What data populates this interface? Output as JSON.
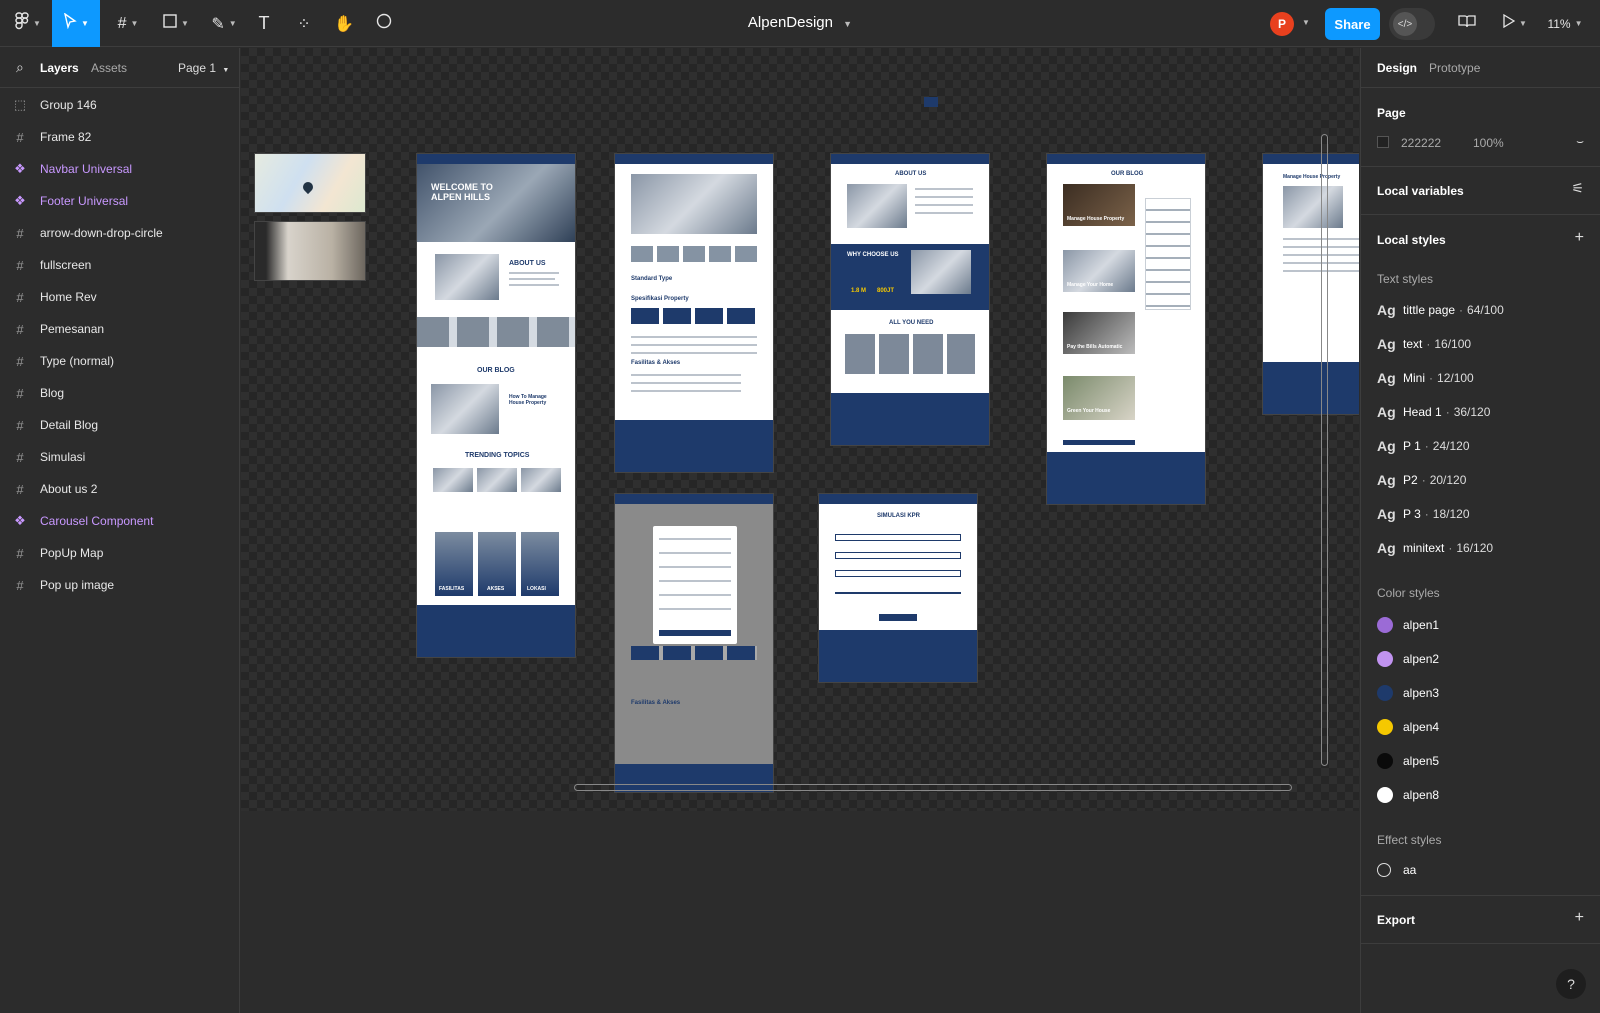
{
  "topbar": {
    "file_name": "AlpenDesign",
    "avatar_initial": "P",
    "share_label": "Share",
    "zoom": "11%"
  },
  "left_panel": {
    "tab_layers": "Layers",
    "tab_assets": "Assets",
    "page_selector": "Page 1",
    "layers": [
      {
        "name": "Group 146",
        "type": "group"
      },
      {
        "name": "Frame 82",
        "type": "frame"
      },
      {
        "name": "Navbar Universal",
        "type": "component"
      },
      {
        "name": "Footer Universal",
        "type": "component"
      },
      {
        "name": "arrow-down-drop-circle",
        "type": "frame"
      },
      {
        "name": "fullscreen",
        "type": "frame"
      },
      {
        "name": "Home Rev",
        "type": "frame"
      },
      {
        "name": "Pemesanan",
        "type": "frame"
      },
      {
        "name": "Type (normal)",
        "type": "frame"
      },
      {
        "name": "Blog",
        "type": "frame"
      },
      {
        "name": "Detail Blog",
        "type": "frame"
      },
      {
        "name": "Simulasi",
        "type": "frame"
      },
      {
        "name": "About us 2",
        "type": "frame"
      },
      {
        "name": "Carousel Component",
        "type": "component"
      },
      {
        "name": "PopUp Map",
        "type": "frame"
      },
      {
        "name": "Pop up image",
        "type": "frame"
      }
    ]
  },
  "canvas": {
    "frames": {
      "home_title": "WELCOME TO ALPEN HILLS",
      "home_about": "ABOUT US",
      "home_blog": "OUR BLOG",
      "home_blog_post": "How To Manage House Property",
      "home_trending": "TRENDING TOPICS",
      "home_cards": [
        "FASILITAS",
        "AKSES",
        "LOKASI"
      ],
      "type_name": "Standard Type",
      "type_spec": "Spesifikasi Property",
      "type_facilities": "Fasilitas & Akses",
      "about_title": "ABOUT US",
      "about_why": "WHY CHOOSE US",
      "about_stat1": "1.8 M",
      "about_stat2": "800JT",
      "about_all": "ALL YOU NEED",
      "blog_title": "OUR BLOG",
      "blog_post1": "Manage House Property",
      "blog_post2": "Manage Your Home",
      "blog_post3": "Pay the Bills Automatic",
      "blog_post4": "Green Your House",
      "detail_title": "Manage House Property",
      "simulasi_title": "SIMULASI KPR",
      "pemesanan_facilities": "Fasilitas & Akses"
    }
  },
  "right_panel": {
    "tab_design": "Design",
    "tab_prototype": "Prototype",
    "page_section": "Page",
    "page_color": "222222",
    "page_opacity": "100%",
    "local_variables": "Local variables",
    "local_styles": "Local styles",
    "text_styles_title": "Text styles",
    "text_styles": [
      {
        "name": "tittle page",
        "spec": "64/100"
      },
      {
        "name": "text",
        "spec": "16/100"
      },
      {
        "name": "Mini",
        "spec": "12/100"
      },
      {
        "name": "Head 1",
        "spec": "36/120"
      },
      {
        "name": "P 1",
        "spec": "24/120"
      },
      {
        "name": "P2",
        "spec": "20/120"
      },
      {
        "name": "P 3",
        "spec": "18/120"
      },
      {
        "name": "minitext",
        "spec": "16/120"
      }
    ],
    "color_styles_title": "Color styles",
    "color_styles": [
      {
        "name": "alpen1",
        "color": "#9b6bd6"
      },
      {
        "name": "alpen2",
        "color": "#c193f0"
      },
      {
        "name": "alpen3",
        "color": "#1e3a6b"
      },
      {
        "name": "alpen4",
        "color": "#f5c800"
      },
      {
        "name": "alpen5",
        "color": "#0a0a0a"
      },
      {
        "name": "alpen8",
        "color": "#ffffff"
      }
    ],
    "effect_styles_title": "Effect styles",
    "effect_style": "aa",
    "export_label": "Export"
  }
}
